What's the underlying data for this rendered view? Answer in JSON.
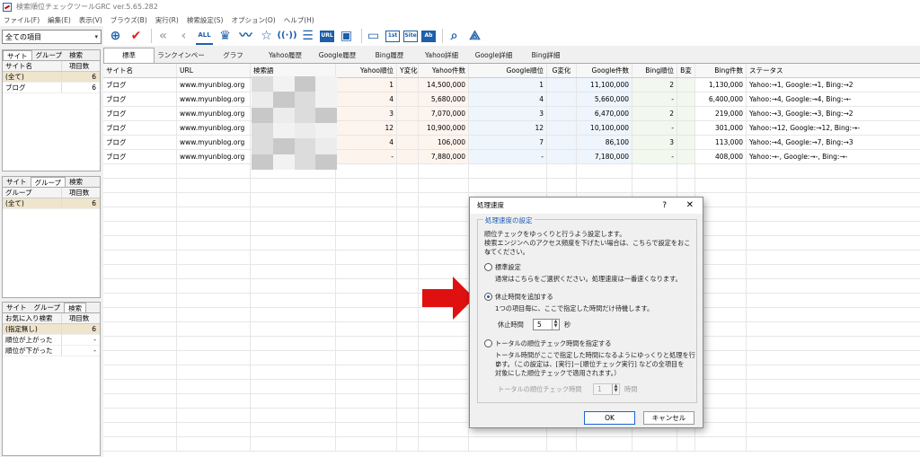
{
  "window": {
    "title": "検索順位チェックツールGRC ver.5.65.282"
  },
  "menu": [
    "ファイル(F)",
    "編集(E)",
    "表示(V)",
    "ブラウズ(B)",
    "実行(R)",
    "検索設定(S)",
    "オプション(O)",
    "ヘルプ(H)"
  ],
  "left": {
    "combo": "全ての項目",
    "panel1": {
      "tabs": [
        "サイト",
        "グループ",
        "検索"
      ],
      "headers": [
        "サイト名",
        "項目数"
      ],
      "rows": [
        {
          "name": "(全て)",
          "count": "6"
        },
        {
          "name": "ブログ",
          "count": "6"
        }
      ]
    },
    "panel2": {
      "tabs": [
        "サイト",
        "グループ",
        "検索"
      ],
      "headers": [
        "グループ",
        "項目数"
      ],
      "rows": [
        {
          "name": "(全て)",
          "count": "6"
        }
      ]
    },
    "panel3": {
      "tabs": [
        "サイト",
        "グループ",
        "検索"
      ],
      "headers": [
        "お気に入り検索",
        "項目数"
      ],
      "rows": [
        {
          "name": "(指定無し)",
          "count": "6"
        },
        {
          "name": "順位が上がった",
          "count": "-"
        },
        {
          "name": "順位が下がった",
          "count": "-"
        }
      ]
    }
  },
  "toolbar": {
    "icons": [
      "add-icon",
      "check-icon",
      "first-icon",
      "back-icon",
      "all-icon",
      "crown-icon",
      "line-chart-icon",
      "star-icon",
      "signal-icon",
      "list-icon",
      "url-icon",
      "lock-icon",
      "window-icon",
      "url-1st-icon",
      "site-icon",
      "ab-icon",
      "zoom-icon",
      "network-icon"
    ]
  },
  "tabs": [
    "標準",
    "ランクインページ",
    "グラフ",
    "Yahoo履歴",
    "Google履歴",
    "Bing履歴",
    "Yahoo詳細",
    "Google詳細",
    "Bing詳細"
  ],
  "grid": {
    "headers": [
      "サイト名",
      "URL",
      "検索語",
      "Yahoo順位",
      "Y変化",
      "Yahoo件数",
      "Google順位",
      "G変化",
      "Google件数",
      "Bing順位",
      "B変",
      "Bing件数",
      "ステータス"
    ],
    "rows": [
      {
        "site": "ブログ",
        "url": "www.myunblog.org",
        "yr": "1",
        "yc": "",
        "yn": "14,500,000",
        "gr": "1",
        "gc": "",
        "gn": "11,100,000",
        "br": "2",
        "bc": "",
        "bn": "1,130,000",
        "status": "Yahoo:→1, Google:→1, Bing:→2"
      },
      {
        "site": "ブログ",
        "url": "www.myunblog.org",
        "yr": "4",
        "yc": "",
        "yn": "5,680,000",
        "gr": "4",
        "gc": "",
        "gn": "5,660,000",
        "br": "-",
        "bc": "",
        "bn": "6,400,000",
        "status": "Yahoo:→4, Google:→4, Bing:→-"
      },
      {
        "site": "ブログ",
        "url": "www.myunblog.org",
        "yr": "3",
        "yc": "",
        "yn": "7,070,000",
        "gr": "3",
        "gc": "",
        "gn": "6,470,000",
        "br": "2",
        "bc": "",
        "bn": "219,000",
        "status": "Yahoo:→3, Google:→3, Bing:→2"
      },
      {
        "site": "ブログ",
        "url": "www.myunblog.org",
        "yr": "12",
        "yc": "",
        "yn": "10,900,000",
        "gr": "12",
        "gc": "",
        "gn": "10,100,000",
        "br": "-",
        "bc": "",
        "bn": "301,000",
        "status": "Yahoo:→12, Google:→12, Bing:→-"
      },
      {
        "site": "ブログ",
        "url": "www.myunblog.org",
        "yr": "4",
        "yc": "",
        "yn": "106,000",
        "gr": "7",
        "gc": "",
        "gn": "86,100",
        "br": "3",
        "bc": "",
        "bn": "113,000",
        "status": "Yahoo:→4, Google:→7, Bing:→3"
      },
      {
        "site": "ブログ",
        "url": "www.myunblog.org",
        "yr": "-",
        "yc": "",
        "yn": "7,880,000",
        "gr": "-",
        "gc": "",
        "gn": "7,180,000",
        "br": "-",
        "bc": "",
        "bn": "408,000",
        "status": "Yahoo:→-, Google:→-, Bing:→-"
      }
    ]
  },
  "dialog": {
    "title": "処理速度",
    "help": "?",
    "close": "✕",
    "legend": "処理速度の設定",
    "intro1": "順位チェックをゆっくりと行うよう設定します。",
    "intro2": "検索エンジンへのアクセス頻度を下げたい場合は、こちらで設定をおこな",
    "intro3": "ってください。",
    "opt1": "標準設定",
    "opt1_desc": "通常はこちらをご選択ください。処理速度は一番速くなります。",
    "opt2": "休止時間を追加する",
    "opt2_desc": "1つの項目毎に、ここで指定した時間だけ待機します。",
    "pause_label": "休止時間",
    "pause_value": "5",
    "pause_unit": "秒",
    "opt3": "トータルの順位チェック時間を指定する",
    "opt3_desc1": "トータル時間がここで指定した時間になるようにゆっくりと処理を行い",
    "opt3_desc2": "ます。（この設定は、[実行]－[順位チェック実行] などの全項目を",
    "opt3_desc3": "対象にした順位チェックで適用されます。）",
    "total_label": "トータルの順位チェック時間",
    "total_value": "1",
    "total_unit": "時間",
    "ok": "OK",
    "cancel": "キャンセル",
    "selected_option": "休止時間を追加する"
  },
  "colors": {
    "accent": "#1d5fa8",
    "arrow": "#e01010"
  }
}
